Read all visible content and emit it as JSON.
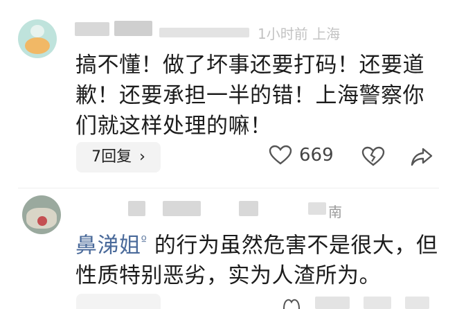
{
  "comments": [
    {
      "meta_tail": "1小时前 上海",
      "text": "搞不懂！做了坏事还要打码！还要道歉！还要承担一半的错！上海警察你们就这样处理的嘛！",
      "reply_label": "7回复",
      "like_count": "669"
    },
    {
      "meta_tail": "南",
      "mention": "鼻涕姐",
      "text": "的行为虽然危害不是很大，但性质特别恶劣，实为人渣所为。"
    }
  ],
  "icons": [
    "heart-icon",
    "broken-heart-icon",
    "share-icon"
  ],
  "colors": {
    "mention": "#4a6a9a",
    "meta": "#9a9a9a",
    "pill": "#f3f3f3"
  }
}
